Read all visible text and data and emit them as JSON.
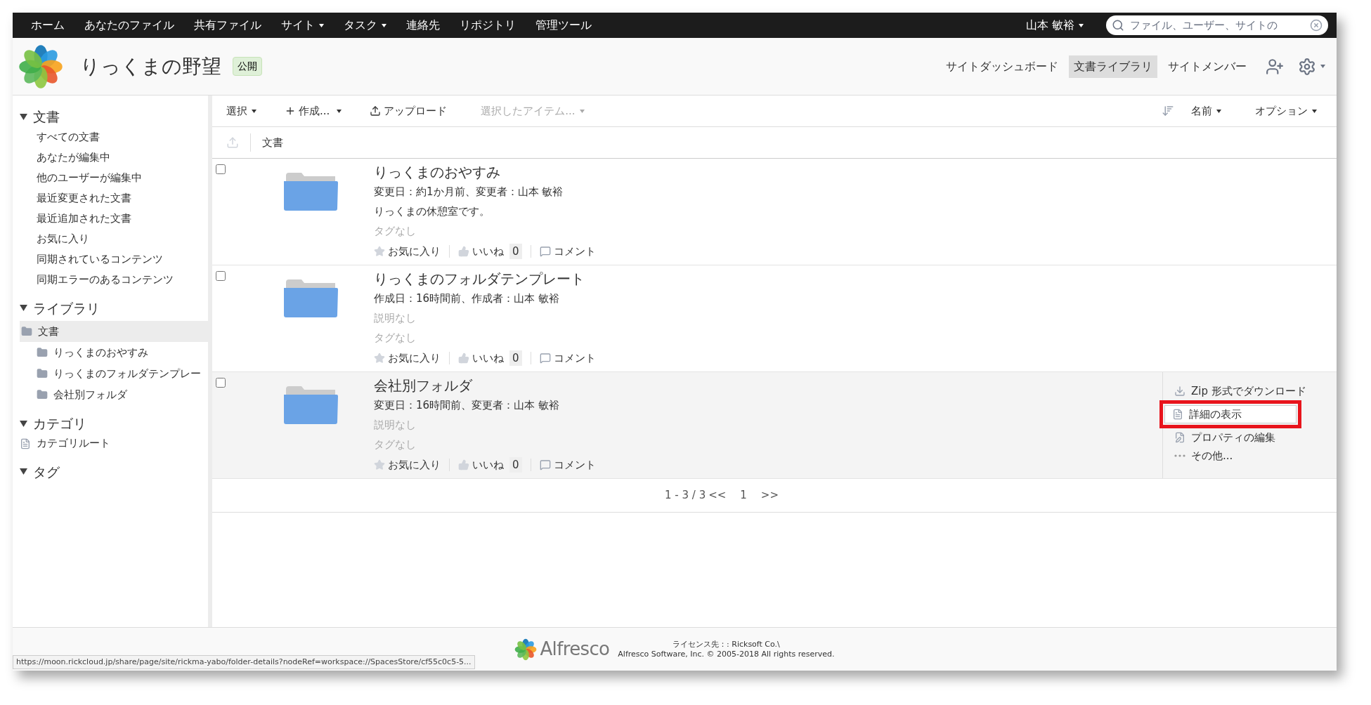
{
  "top_nav": {
    "items": [
      {
        "label": "ホーム",
        "dropdown": false
      },
      {
        "label": "あなたのファイル",
        "dropdown": false
      },
      {
        "label": "共有ファイル",
        "dropdown": false
      },
      {
        "label": "サイト",
        "dropdown": true
      },
      {
        "label": "タスク",
        "dropdown": true
      },
      {
        "label": "連絡先",
        "dropdown": false
      },
      {
        "label": "リポジトリ",
        "dropdown": false
      },
      {
        "label": "管理ツール",
        "dropdown": false
      }
    ],
    "user": {
      "name": "山本 敏裕"
    },
    "search": {
      "placeholder": "ファイル、ユーザー、サイトの"
    }
  },
  "site": {
    "title": "りっくまの野望",
    "badge": "公開",
    "nav": [
      {
        "label": "サイトダッシュボード",
        "selected": false
      },
      {
        "label": "文書ライブラリ",
        "selected": true
      },
      {
        "label": "サイトメンバー",
        "selected": false
      }
    ]
  },
  "sidebar": {
    "sections": [
      {
        "title": "文書",
        "kind": "links",
        "expanded": true,
        "items": [
          {
            "label": "すべての文書"
          },
          {
            "label": "あなたが編集中"
          },
          {
            "label": "他のユーザーが編集中"
          },
          {
            "label": "最近変更された文書"
          },
          {
            "label": "最近追加された文書"
          },
          {
            "label": "お気に入り"
          },
          {
            "label": "同期されているコンテンツ"
          },
          {
            "label": "同期エラーのあるコンテンツ"
          }
        ]
      },
      {
        "title": "ライブラリ",
        "kind": "tree",
        "expanded": true,
        "items": [
          {
            "label": "文書",
            "selected": true,
            "children": [
              {
                "label": "りっくまのおやすみ",
                "selected": false
              },
              {
                "label": "りっくまのフォルダテンプレー",
                "selected": false
              },
              {
                "label": "会社別フォルダ",
                "selected": false
              }
            ]
          }
        ]
      },
      {
        "title": "カテゴリ",
        "kind": "category",
        "expanded": true,
        "items": [
          {
            "label": "カテゴリルート"
          }
        ]
      },
      {
        "title": "タグ",
        "kind": "links",
        "expanded": true
      }
    ]
  },
  "toolbar": {
    "select": "選択",
    "create": "作成...",
    "upload": "アップロード",
    "selected_items": "選択したアイテム...",
    "sort": "名前",
    "options": "オプション"
  },
  "breadcrumb": "文書",
  "rows": [
    {
      "title": "りっくまのおやすみ",
      "meta": "変更日：約1か月前、変更者：山本 敏裕",
      "description": "りっくまの休憩室です。",
      "description_empty": false,
      "tags": "タグなし",
      "favorite": "お気に入り",
      "like": "いいね",
      "like_count": "0",
      "comment": "コメント",
      "hovered": false
    },
    {
      "title": "りっくまのフォルダテンプレート",
      "meta": "作成日：16時間前、作成者：山本 敏裕",
      "description": "説明なし",
      "description_empty": true,
      "tags": "タグなし",
      "favorite": "お気に入り",
      "like": "いいね",
      "like_count": "0",
      "comment": "コメント",
      "hovered": false
    },
    {
      "title": "会社別フォルダ",
      "meta": "変更日：16時間前、変更者：山本 敏裕",
      "description": "説明なし",
      "description_empty": true,
      "tags": "タグなし",
      "favorite": "お気に入り",
      "like": "いいね",
      "like_count": "0",
      "comment": "コメント",
      "hovered": true,
      "actions": [
        {
          "kind": "download",
          "label": "Zip 形式でダウンロード",
          "focused": false
        },
        {
          "kind": "details",
          "label": "詳細の表示",
          "focused": true
        },
        {
          "kind": "edit",
          "label": "プロパティの編集",
          "focused": false
        },
        {
          "kind": "more",
          "label": "その他...",
          "focused": false
        }
      ]
    }
  ],
  "pagination": {
    "range": "1 - 3 / 3",
    "prev": "<<",
    "page": "1",
    "next": ">>"
  },
  "footer": {
    "logo_text": "Alfresco",
    "license": "ライセンス先：: Ricksoft Co.\\",
    "copyright": "Alfresco Software, Inc. © 2005-2018 All rights reserved."
  },
  "status_url": "https://moon.rickcloud.jp/share/page/site/rickma-yabo/folder-details?nodeRef=workspace://SpacesStore/cf55c0c5-5...",
  "annotation": {
    "highlight": true
  }
}
